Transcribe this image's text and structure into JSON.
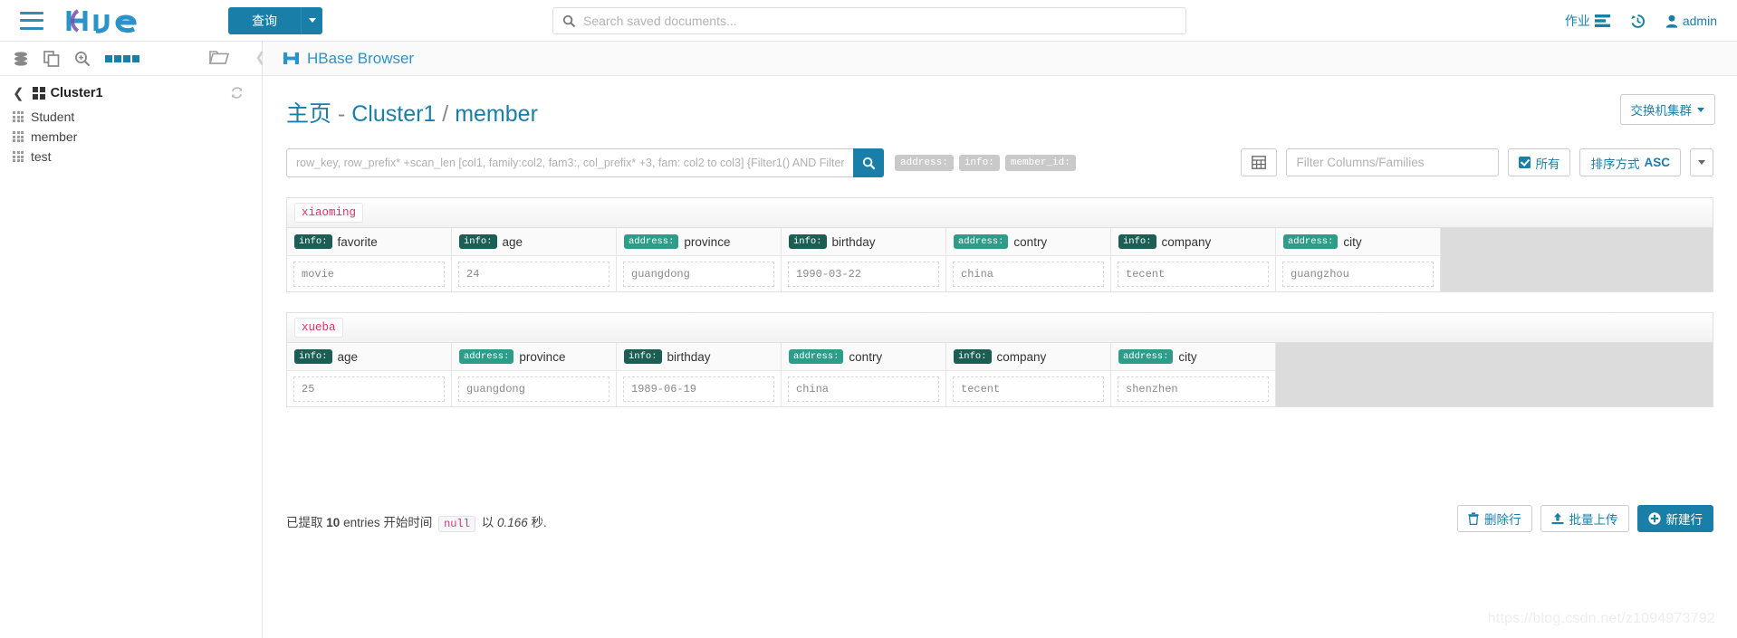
{
  "navbar": {
    "menu_icon": "hamburger-icon",
    "logo_text": "hue",
    "query_button": "查询",
    "doc_search_placeholder": "Search saved documents...",
    "doc_search_value": "",
    "jobs_label": "作业",
    "history_icon": "history-icon",
    "user_label": "admin"
  },
  "assist": {
    "icons": [
      "database-icon",
      "documents-icon",
      "search-zoom-icon",
      "grid-icon"
    ],
    "folder_icon": "folder-icon",
    "collapse_icon": "chevron-left-icon",
    "cluster_name": "Cluster1",
    "refresh_icon": "refresh-icon",
    "tables": [
      {
        "label": "Student"
      },
      {
        "label": "member"
      },
      {
        "label": "test"
      }
    ]
  },
  "app": {
    "title": "HBase Browser",
    "logo_icon": "hbase-logo-icon"
  },
  "breadcrumb": {
    "home": "主页",
    "dash": "-",
    "cluster": "Cluster1",
    "slash": "/",
    "table": "member"
  },
  "switch_cluster_label": "交换机集群",
  "toolbar": {
    "smart_search_placeholder": "row_key, row_prefix* +scan_len [col1, family:col2, fam3:, col_prefix* +3, fam: col2 to col3] {Filter1() AND Filter2()}",
    "smart_search_value": "",
    "family_tags": [
      "address:",
      "info:",
      "member_id:"
    ],
    "columns_toggle_icon": "table-columns-icon",
    "filter_columns_placeholder": "Filter Columns/Families",
    "filter_columns_value": "",
    "all_label": "所有",
    "all_checked": true,
    "sort_label": "排序方式",
    "sort_direction": "ASC"
  },
  "rows": [
    {
      "row_key": "xiaoming",
      "cells": [
        {
          "family": "info:",
          "column": "favorite",
          "value": "movie"
        },
        {
          "family": "info:",
          "column": "age",
          "value": "24"
        },
        {
          "family": "address:",
          "column": "province",
          "value": "guangdong"
        },
        {
          "family": "info:",
          "column": "birthday",
          "value": "1990-03-22"
        },
        {
          "family": "address:",
          "column": "contry",
          "value": "china"
        },
        {
          "family": "info:",
          "column": "company",
          "value": "tecent"
        },
        {
          "family": "address:",
          "column": "city",
          "value": "guangzhou"
        }
      ]
    },
    {
      "row_key": "xueba",
      "cells": [
        {
          "family": "info:",
          "column": "age",
          "value": "25"
        },
        {
          "family": "address:",
          "column": "province",
          "value": "guangdong"
        },
        {
          "family": "info:",
          "column": "birthday",
          "value": "1989-06-19"
        },
        {
          "family": "address:",
          "column": "contry",
          "value": "china"
        },
        {
          "family": "info:",
          "column": "company",
          "value": "tecent"
        },
        {
          "family": "address:",
          "column": "city",
          "value": "shenzhen"
        }
      ]
    }
  ],
  "footer": {
    "status_prefix": "已提取",
    "status_count": "10",
    "status_mid": "entries 开始时间",
    "status_null": "null",
    "status_with": "以",
    "status_seconds": "0.166",
    "status_suffix": "秒.",
    "delete_row_label": "删除行",
    "bulk_upload_label": "批量上传",
    "new_row_label": "新建行"
  },
  "watermark": "https://blog.csdn.net/z1094973792",
  "colors": {
    "brand_blue": "#1a7fa8",
    "link_blue": "#2a93c9",
    "family_info": "#1b5e53",
    "family_address": "#2d9d8a",
    "rowkey_pink": "#e32b65",
    "grid_empty_gray": "#dcdcdc"
  }
}
